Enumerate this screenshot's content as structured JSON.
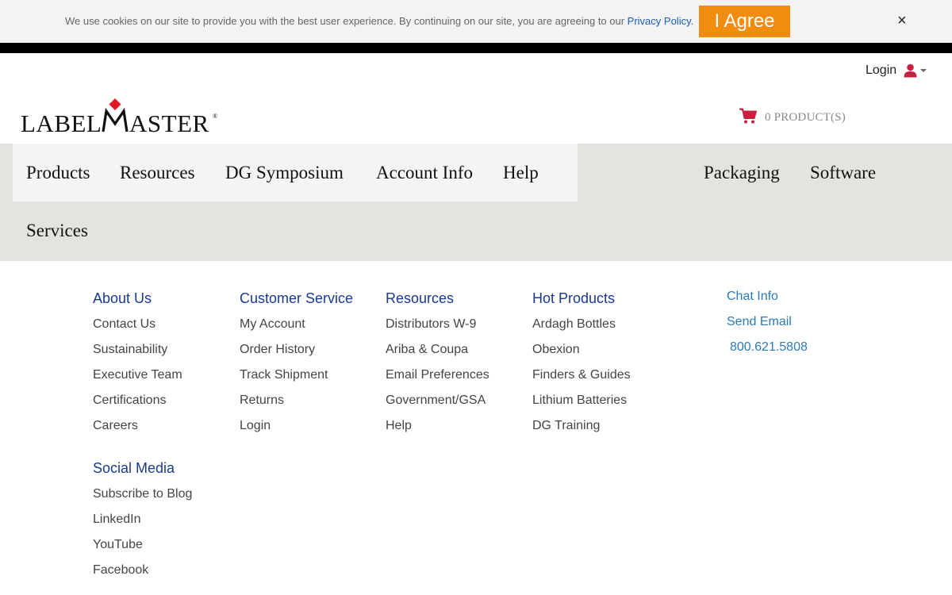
{
  "cookie_banner": {
    "text": "We use cookies on our site to provide you with the best user experience. By continuing on our site, you are agreeing to our ",
    "policy_link": "Privacy Policy",
    "period": ".",
    "agree_label": "I Agree",
    "close_label": "×"
  },
  "header": {
    "login_label": "Login",
    "logo_text_left": "LABEL",
    "logo_text_right": "ASTER",
    "logo_reg": "®",
    "cart_label": "0 PRODUCT(S)"
  },
  "nav": {
    "items": [
      "Products",
      "Resources",
      "DG Symposium",
      "Account Info",
      "Help",
      "Packaging",
      "Software",
      "Services"
    ]
  },
  "footer": {
    "about": {
      "heading": "About Us",
      "links": [
        "Contact Us",
        "Sustainability",
        "Executive Team",
        "Certifications",
        "Careers"
      ]
    },
    "customer_service": {
      "heading": "Customer Service",
      "links": [
        "My Account",
        "Order History",
        "Track Shipment",
        "Returns",
        "Login"
      ]
    },
    "resources": {
      "heading": "Resources",
      "links": [
        "Distributors W-9",
        "Ariba & Coupa",
        "Email Preferences",
        "Government/GSA",
        "Help"
      ]
    },
    "hot_products": {
      "heading": "Hot Products",
      "links": [
        "Ardagh Bottles",
        "Obexion",
        "Finders & Guides",
        "Lithium Batteries",
        "DG Training"
      ]
    },
    "social": {
      "heading": "Social Media",
      "links": [
        "Subscribe to Blog",
        "LinkedIn",
        "YouTube",
        "Facebook"
      ]
    },
    "contact": {
      "chat": "Chat Info",
      "email": "Send Email",
      "phone": "800.621.5808"
    }
  },
  "colors": {
    "accent_orange": "#f28c0f",
    "brand_red": "#e01b24",
    "icon_crimson": "#c8203f",
    "heading_blue": "#1a3a8f",
    "link_blue": "#2a7ab8",
    "nav_bg": "#e4e4df"
  }
}
